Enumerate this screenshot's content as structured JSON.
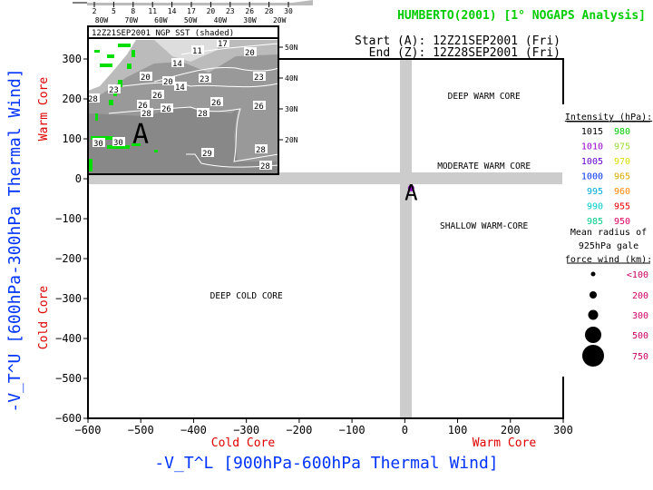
{
  "title": "HUMBERTO(2001) [1° NOGAPS Analysis]",
  "title_color": "#00cc00",
  "start_label": "Start (A): 12Z21SEP2001 (Fri)",
  "end_label": "End (Z): 12Z28SEP2001 (Fri)",
  "inset": {
    "title": "12Z21SEP2001 NGP SST (shaded)",
    "colorbar_ticks": [
      "2",
      "5",
      "8",
      "11",
      "14",
      "17",
      "20",
      "23",
      "26",
      "28",
      "30"
    ],
    "lon_labels": [
      "80W",
      "70W",
      "60W",
      "50W",
      "40W",
      "30W",
      "20W"
    ],
    "lat_labels": [
      "50N",
      "40N",
      "30N",
      "20N"
    ],
    "contour_labels": [
      "11",
      "14",
      "14",
      "17",
      "20",
      "20",
      "20",
      "23",
      "23",
      "23",
      "26",
      "26",
      "26",
      "26",
      "26",
      "28",
      "28",
      "28",
      "28",
      "28",
      "29",
      "30",
      "30"
    ],
    "storm_marker": "A"
  },
  "chart_data": {
    "type": "scatter",
    "title": "HUMBERTO(2001) [1° NOGAPS Analysis]",
    "xlabel": "-V_T^L [900hPa-600hPa Thermal Wind]",
    "ylabel": "-V_T^U [600hPa-300hPa Thermal Wind]",
    "xlim": [
      -600,
      300
    ],
    "ylim": [
      -600,
      300
    ],
    "xticks": [
      -600,
      -500,
      -400,
      -300,
      -200,
      -100,
      0,
      100,
      200,
      300
    ],
    "yticks": [
      -600,
      -500,
      -400,
      -300,
      -200,
      -100,
      0,
      100,
      200,
      300
    ],
    "x_tick_labels": [
      "−600",
      "−500",
      "−400",
      "−300",
      "−200",
      "−100",
      "0",
      "100",
      "200",
      "300"
    ],
    "y_tick_labels": [
      "−600",
      "−500",
      "−400",
      "−300",
      "−200",
      "−100",
      "0",
      "100",
      "200",
      "300"
    ],
    "x_core_labels": {
      "cold": "Cold Core",
      "warm": "Warm Core"
    },
    "y_core_labels": {
      "cold": "Cold Core",
      "warm": "Warm Core"
    },
    "region_labels": [
      {
        "text": "DEEP WARM CORE",
        "x": 150,
        "y": 200
      },
      {
        "text": "MODERATE WARM CORE",
        "x": 150,
        "y": 25
      },
      {
        "text": "SHALLOW WARM-CORE",
        "x": 150,
        "y": -125
      },
      {
        "text": "DEEP COLD CORE",
        "x": -300,
        "y": -300
      }
    ],
    "points": [
      {
        "label": "A",
        "x": 12,
        "y": -35,
        "mslp_hPa": 1010,
        "color": "#9900cc"
      }
    ],
    "grid": false,
    "legend": {
      "placement": "right",
      "intensity_title": "Intensity (hPa):",
      "intensity": [
        {
          "left": "1015",
          "left_color": "#000000",
          "right": "980",
          "right_color": "#00cc00"
        },
        {
          "left": "1010",
          "left_color": "#9900cc",
          "right": "975",
          "right_color": "#99dd33"
        },
        {
          "left": "1005",
          "left_color": "#6600cc",
          "right": "970",
          "right_color": "#dddd00"
        },
        {
          "left": "1000",
          "left_color": "#0033ee",
          "right": "965",
          "right_color": "#ddaa00"
        },
        {
          "left": "995",
          "left_color": "#00aadd",
          "right": "960",
          "right_color": "#ff8800"
        },
        {
          "left": "990",
          "left_color": "#00cccc",
          "right": "955",
          "right_color": "#ee0000"
        },
        {
          "left": "985",
          "left_color": "#00cc88",
          "right": "950",
          "right_color": "#dd0066"
        }
      ],
      "radius_title": [
        "Mean radius of",
        "925hPa gale",
        "force wind (km):"
      ],
      "radius": [
        {
          "label": "<100",
          "km": 100
        },
        {
          "label": "200",
          "km": 200
        },
        {
          "label": "300",
          "km": 300
        },
        {
          "label": "500",
          "km": 500
        },
        {
          "label": "750",
          "km": 750
        }
      ],
      "radius_label_color": "#cc0066"
    }
  },
  "colors": {
    "axis_title": "#0033ff",
    "core_label": "#dd0000",
    "zero_band": "#cccccc"
  }
}
